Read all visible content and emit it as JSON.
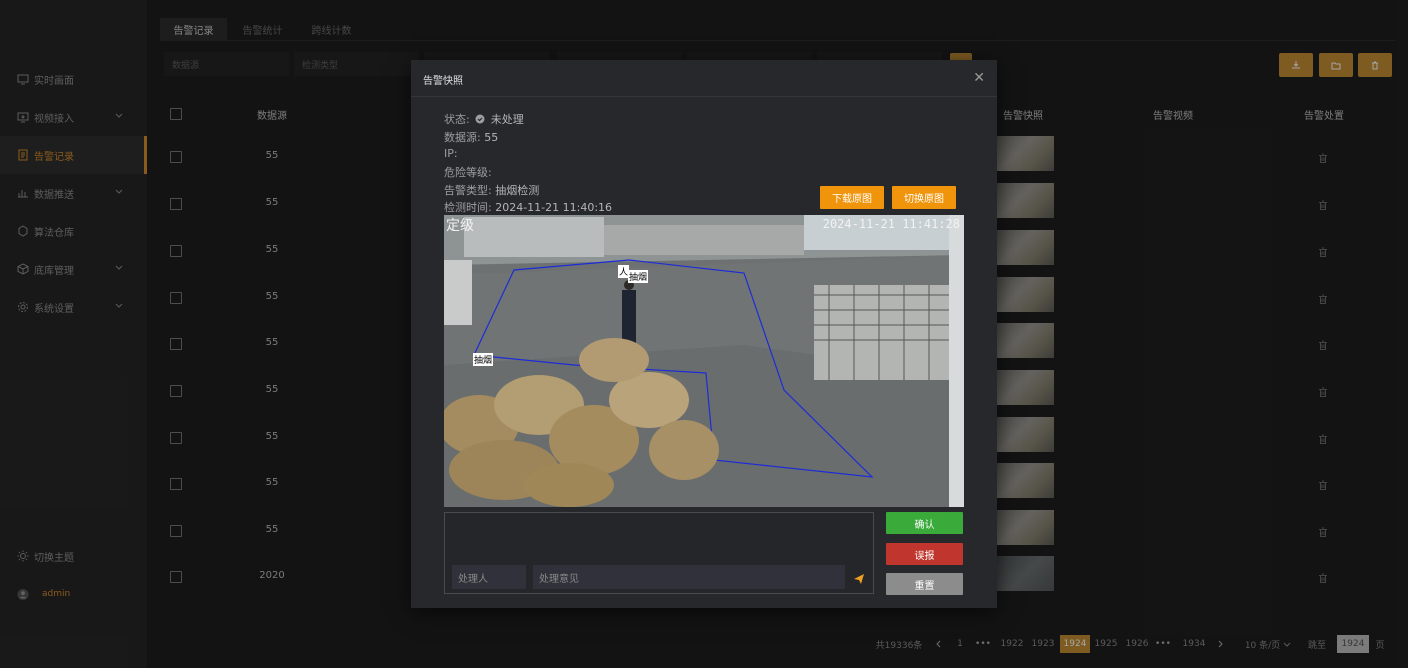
{
  "sidebar": {
    "items": [
      {
        "label": "实时画面",
        "icon": "monitor-icon"
      },
      {
        "label": "视频接入",
        "icon": "video-input-icon"
      },
      {
        "label": "告警记录",
        "icon": "alarm-record-icon"
      },
      {
        "label": "数据推送",
        "icon": "data-push-icon"
      },
      {
        "label": "算法仓库",
        "icon": "algorithm-icon"
      },
      {
        "label": "底库管理",
        "icon": "database-icon"
      },
      {
        "label": "系统设置",
        "icon": "gear-icon"
      }
    ],
    "theme_label": "切换主题",
    "user_label": "admin"
  },
  "tabs": [
    {
      "label": "告警记录"
    },
    {
      "label": "告警统计"
    },
    {
      "label": "跨线计数"
    }
  ],
  "filters": {
    "source_placeholder": "数据源",
    "type_placeholder": "检测类型"
  },
  "table": {
    "headers": {
      "source": "数据源",
      "snapshot": "告警快照",
      "video": "告警视频",
      "handle": "告警处置"
    },
    "rows": [
      {
        "source": "55"
      },
      {
        "source": "55"
      },
      {
        "source": "55"
      },
      {
        "source": "55"
      },
      {
        "source": "55"
      },
      {
        "source": "55"
      },
      {
        "source": "55"
      },
      {
        "source": "55"
      },
      {
        "source": "55"
      },
      {
        "source": "2020"
      }
    ]
  },
  "pagination": {
    "total": "共19336条",
    "pages": [
      "1",
      "•••",
      "1922",
      "1923",
      "1924",
      "1925",
      "1926",
      "•••",
      "1934"
    ],
    "current": "1924",
    "page_size": "10 条/页",
    "goto_label": "跳至",
    "goto_value": "1924",
    "page_unit": "页"
  },
  "modal": {
    "title": "告警快照",
    "status_label": "状态:",
    "status_value": "未处理",
    "source_label": "数据源:",
    "source_value": "55",
    "ip_label": "IP:",
    "ip_value": "",
    "danger_label": "危险等级:",
    "danger_value": "",
    "type_label": "告警类型:",
    "type_value": "抽烟检测",
    "time_label": "检测时间:",
    "time_value": "2024-11-21 11:40:16",
    "download_btn": "下载原图",
    "switch_btn": "切换原图",
    "snapshot": {
      "overlay_left": "定级",
      "overlay_timestamp": "2024-11-21 11:41:28",
      "label_person": "人",
      "label_smoke1": "抽烟",
      "label_smoke2": "抽烟"
    },
    "handler_placeholder": "处理人",
    "opinion_placeholder": "处理意见",
    "confirm_btn": "确认",
    "false_alarm_btn": "误报",
    "reset_btn": "重置"
  },
  "colors": {
    "accent": "#d58c2c",
    "orange_button": "#f0950b",
    "confirm": "#3aaa3a",
    "false_alarm": "#c0352d",
    "reset": "#8c8c8c"
  }
}
